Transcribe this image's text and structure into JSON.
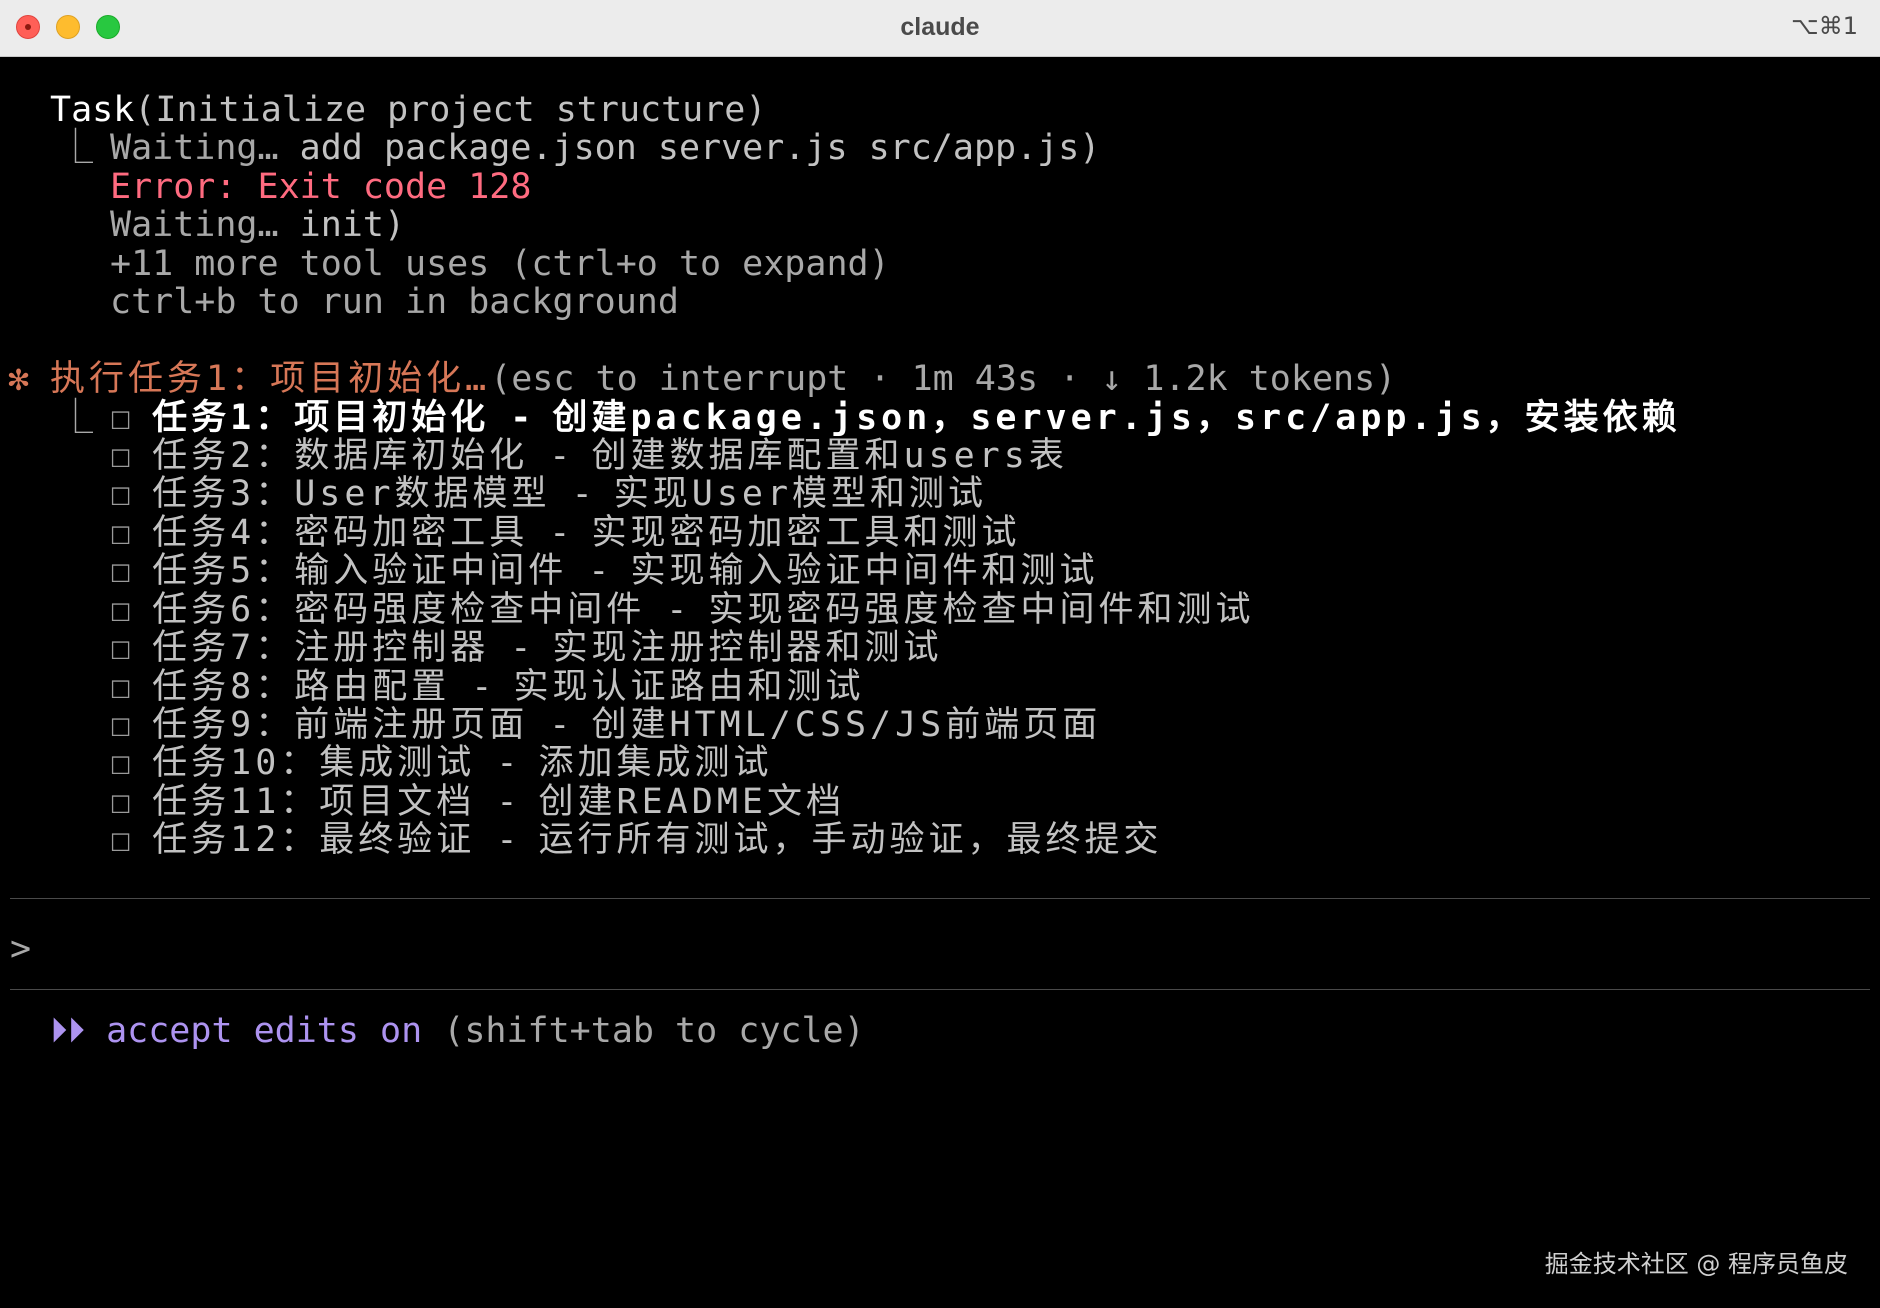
{
  "window": {
    "title": "claude",
    "shortcut": "⌥⌘1"
  },
  "task": {
    "name": "Task",
    "args": "(Initialize project structure)",
    "tree_connector": "⎿",
    "lines": [
      {
        "text": "Waiting… ",
        "rest": "add package.json server.js src/app.js)"
      },
      {
        "text": "Error: Exit code 128"
      },
      {
        "text": "Waiting… ",
        "rest": "init)"
      },
      {
        "text": "+11 more tool uses (ctrl+o to expand)"
      },
      {
        "text": "ctrl+b to run in background"
      }
    ]
  },
  "status": {
    "spinner": "✻",
    "label": "执行任务1：项目初始化…",
    "hint": "(esc to interrupt · 1m 43s · ↓ 1.2k tokens)"
  },
  "todos": {
    "checkbox": "☐",
    "items": [
      {
        "title": "任务1：项目初始化",
        "sep": " - ",
        "desc": "创建package.json，server.js，src/app.js，安装依赖",
        "active": true
      },
      {
        "title": "任务2：数据库初始化",
        "sep": " - ",
        "desc": "创建数据库配置和users表",
        "active": false
      },
      {
        "title": "任务3：User数据模型",
        "sep": " - ",
        "desc": "实现User模型和测试",
        "active": false
      },
      {
        "title": "任务4：密码加密工具",
        "sep": " - ",
        "desc": "实现密码加密工具和测试",
        "active": false
      },
      {
        "title": "任务5：输入验证中间件",
        "sep": " - ",
        "desc": "实现输入验证中间件和测试",
        "active": false
      },
      {
        "title": "任务6：密码强度检查中间件",
        "sep": " - ",
        "desc": "实现密码强度检查中间件和测试",
        "active": false
      },
      {
        "title": "任务7：注册控制器",
        "sep": " - ",
        "desc": "实现注册控制器和测试",
        "active": false
      },
      {
        "title": "任务8：路由配置",
        "sep": " - ",
        "desc": "实现认证路由和测试",
        "active": false
      },
      {
        "title": "任务9：前端注册页面",
        "sep": " - ",
        "desc": "创建HTML/CSS/JS前端页面",
        "active": false
      },
      {
        "title": "任务10：集成测试",
        "sep": " - ",
        "desc": "添加集成测试",
        "active": false
      },
      {
        "title": "任务11：项目文档",
        "sep": " - ",
        "desc": "创建README文档",
        "active": false
      },
      {
        "title": "任务12：最终验证",
        "sep": " - ",
        "desc": "运行所有测试，手动验证，最终提交",
        "active": false
      }
    ]
  },
  "input": {
    "prompt": ">",
    "value": ""
  },
  "mode": {
    "icon": "⏵⏵",
    "label": "accept edits on",
    "hint": "(shift+tab to cycle)"
  },
  "watermark": "掘金技术社区 @ 程序员鱼皮",
  "colors": {
    "error": "#ff6b80",
    "status": "#d77757",
    "mode": "#ad93f0"
  }
}
